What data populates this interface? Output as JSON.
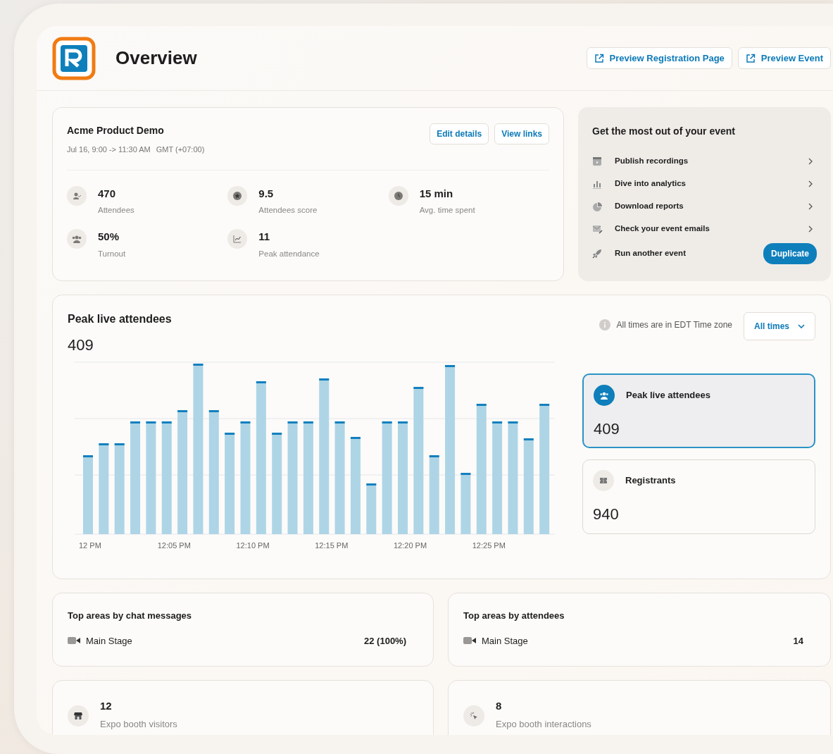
{
  "header": {
    "title": "Overview",
    "buttons": [
      {
        "label": "Preview Registration Page"
      },
      {
        "label": "Preview Event"
      }
    ]
  },
  "event": {
    "name": "Acme Product Demo",
    "date": "Jul 16, 9:00 -> 11:30 AM",
    "timezone": "GMT (+07:00)",
    "actions": [
      {
        "label": "Edit details"
      },
      {
        "label": "View links"
      }
    ],
    "stats": [
      {
        "kind": "attendees",
        "value": "470",
        "label": "Attendees"
      },
      {
        "kind": "score",
        "value": "9.5",
        "label": "Attendees score"
      },
      {
        "kind": "time",
        "value": "15 min",
        "label": "Avg. time spent"
      },
      {
        "kind": "turnout",
        "value": "50%",
        "label": "Turnout"
      },
      {
        "kind": "peak",
        "value": "11",
        "label": "Peak attendance"
      }
    ]
  },
  "tips": {
    "title": "Get the most out of your event",
    "items": [
      {
        "kind": "recordings",
        "label": "Publish recordings"
      },
      {
        "kind": "analytics",
        "label": "Dive into analytics"
      },
      {
        "kind": "reports",
        "label": "Download reports"
      },
      {
        "kind": "emails",
        "label": "Check your event emails"
      },
      {
        "kind": "rocket",
        "label": "Run another event",
        "button": "Duplicate"
      }
    ]
  },
  "chart_panel": {
    "title": "Peak live attendees",
    "value": "409",
    "timezone_note": "All times are in EDT Time zone",
    "range_select": {
      "value": "All times"
    },
    "x_labels": [
      "12 PM",
      "12:05 PM",
      "12:10 PM",
      "12:15 PM",
      "12:20 PM",
      "12:25 PM"
    ],
    "metric_cards": [
      {
        "kind": "people",
        "label": "Peak live attendees",
        "value": "409",
        "selected": true
      },
      {
        "kind": "ticket",
        "label": "Registrants",
        "value": "940",
        "selected": false
      }
    ]
  },
  "top_areas": [
    {
      "title": "Top areas by chat messages",
      "rows": [
        {
          "label": "Main Stage",
          "value": "22 (100%)"
        }
      ]
    },
    {
      "title": "Top areas by attendees",
      "rows": [
        {
          "label": "Main Stage",
          "value": "14"
        }
      ]
    }
  ],
  "expo": [
    {
      "kind": "booth",
      "value": "12",
      "label": "Expo booth visitors"
    },
    {
      "kind": "click",
      "value": "8",
      "label": "Expo booth interactions"
    }
  ]
}
